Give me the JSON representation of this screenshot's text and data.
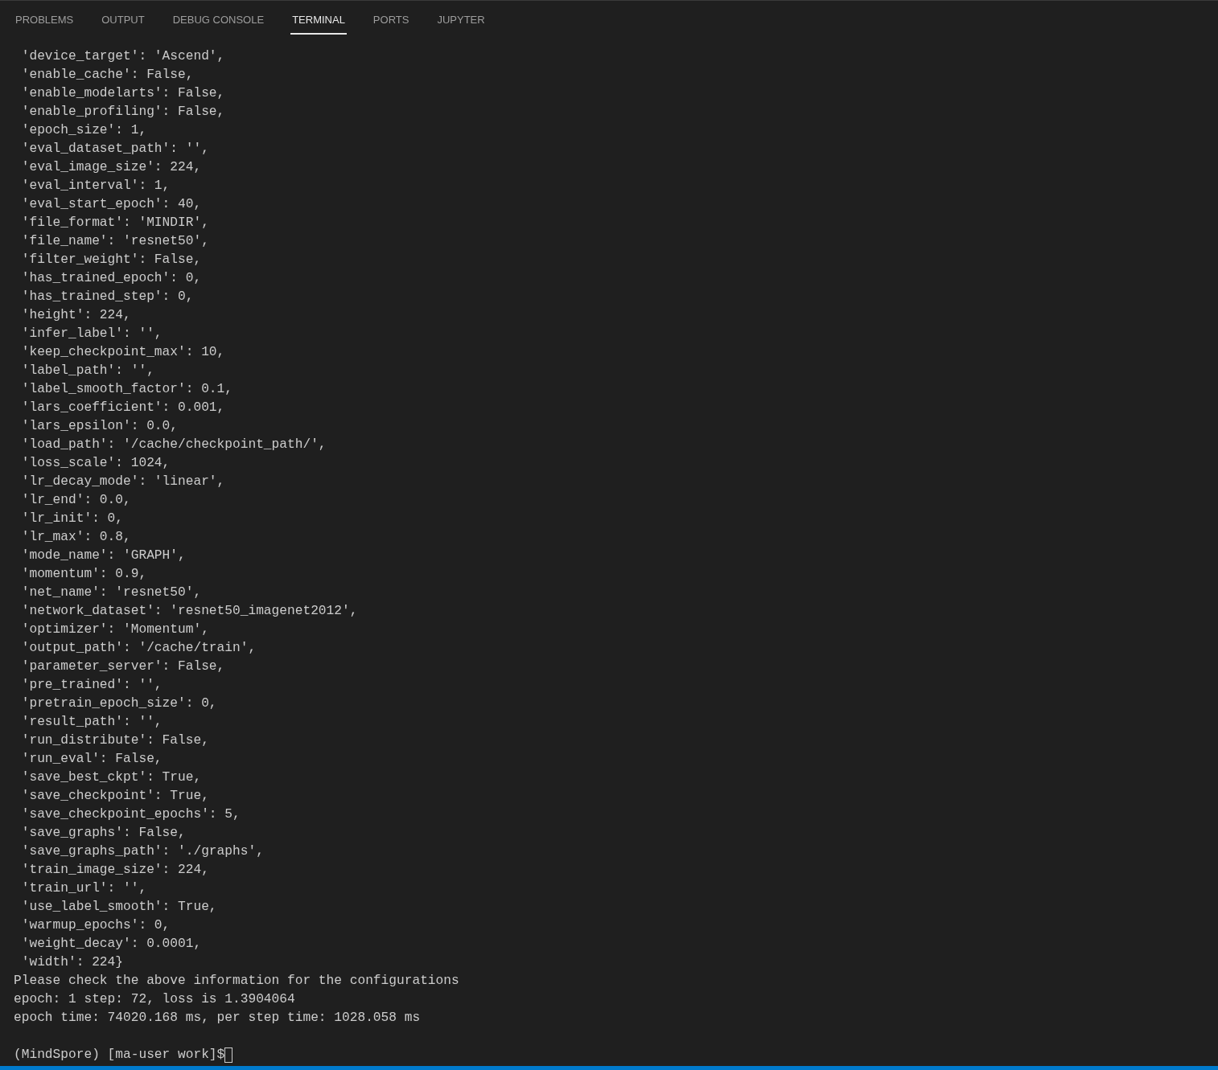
{
  "tabs": [
    {
      "label": "PROBLEMS",
      "selected": false
    },
    {
      "label": "OUTPUT",
      "selected": false
    },
    {
      "label": "DEBUG CONSOLE",
      "selected": false
    },
    {
      "label": "TERMINAL",
      "selected": true
    },
    {
      "label": "PORTS",
      "selected": false
    },
    {
      "label": "JUPYTER",
      "selected": false
    }
  ],
  "terminal": {
    "lines": [
      " 'device_target': 'Ascend',",
      " 'enable_cache': False,",
      " 'enable_modelarts': False,",
      " 'enable_profiling': False,",
      " 'epoch_size': 1,",
      " 'eval_dataset_path': '',",
      " 'eval_image_size': 224,",
      " 'eval_interval': 1,",
      " 'eval_start_epoch': 40,",
      " 'file_format': 'MINDIR',",
      " 'file_name': 'resnet50',",
      " 'filter_weight': False,",
      " 'has_trained_epoch': 0,",
      " 'has_trained_step': 0,",
      " 'height': 224,",
      " 'infer_label': '',",
      " 'keep_checkpoint_max': 10,",
      " 'label_path': '',",
      " 'label_smooth_factor': 0.1,",
      " 'lars_coefficient': 0.001,",
      " 'lars_epsilon': 0.0,",
      " 'load_path': '/cache/checkpoint_path/',",
      " 'loss_scale': 1024,",
      " 'lr_decay_mode': 'linear',",
      " 'lr_end': 0.0,",
      " 'lr_init': 0,",
      " 'lr_max': 0.8,",
      " 'mode_name': 'GRAPH',",
      " 'momentum': 0.9,",
      " 'net_name': 'resnet50',",
      " 'network_dataset': 'resnet50_imagenet2012',",
      " 'optimizer': 'Momentum',",
      " 'output_path': '/cache/train',",
      " 'parameter_server': False,",
      " 'pre_trained': '',",
      " 'pretrain_epoch_size': 0,",
      " 'result_path': '',",
      " 'run_distribute': False,",
      " 'run_eval': False,",
      " 'save_best_ckpt': True,",
      " 'save_checkpoint': True,",
      " 'save_checkpoint_epochs': 5,",
      " 'save_graphs': False,",
      " 'save_graphs_path': './graphs',",
      " 'train_image_size': 224,",
      " 'train_url': '',",
      " 'use_label_smooth': True,",
      " 'warmup_epochs': 0,",
      " 'weight_decay': 0.0001,",
      " 'width': 224}",
      "Please check the above information for the configurations",
      "epoch: 1 step: 72, loss is 1.3904064",
      "epoch time: 74020.168 ms, per step time: 1028.058 ms"
    ],
    "prompt": "(MindSpore) [ma-user work]$"
  }
}
